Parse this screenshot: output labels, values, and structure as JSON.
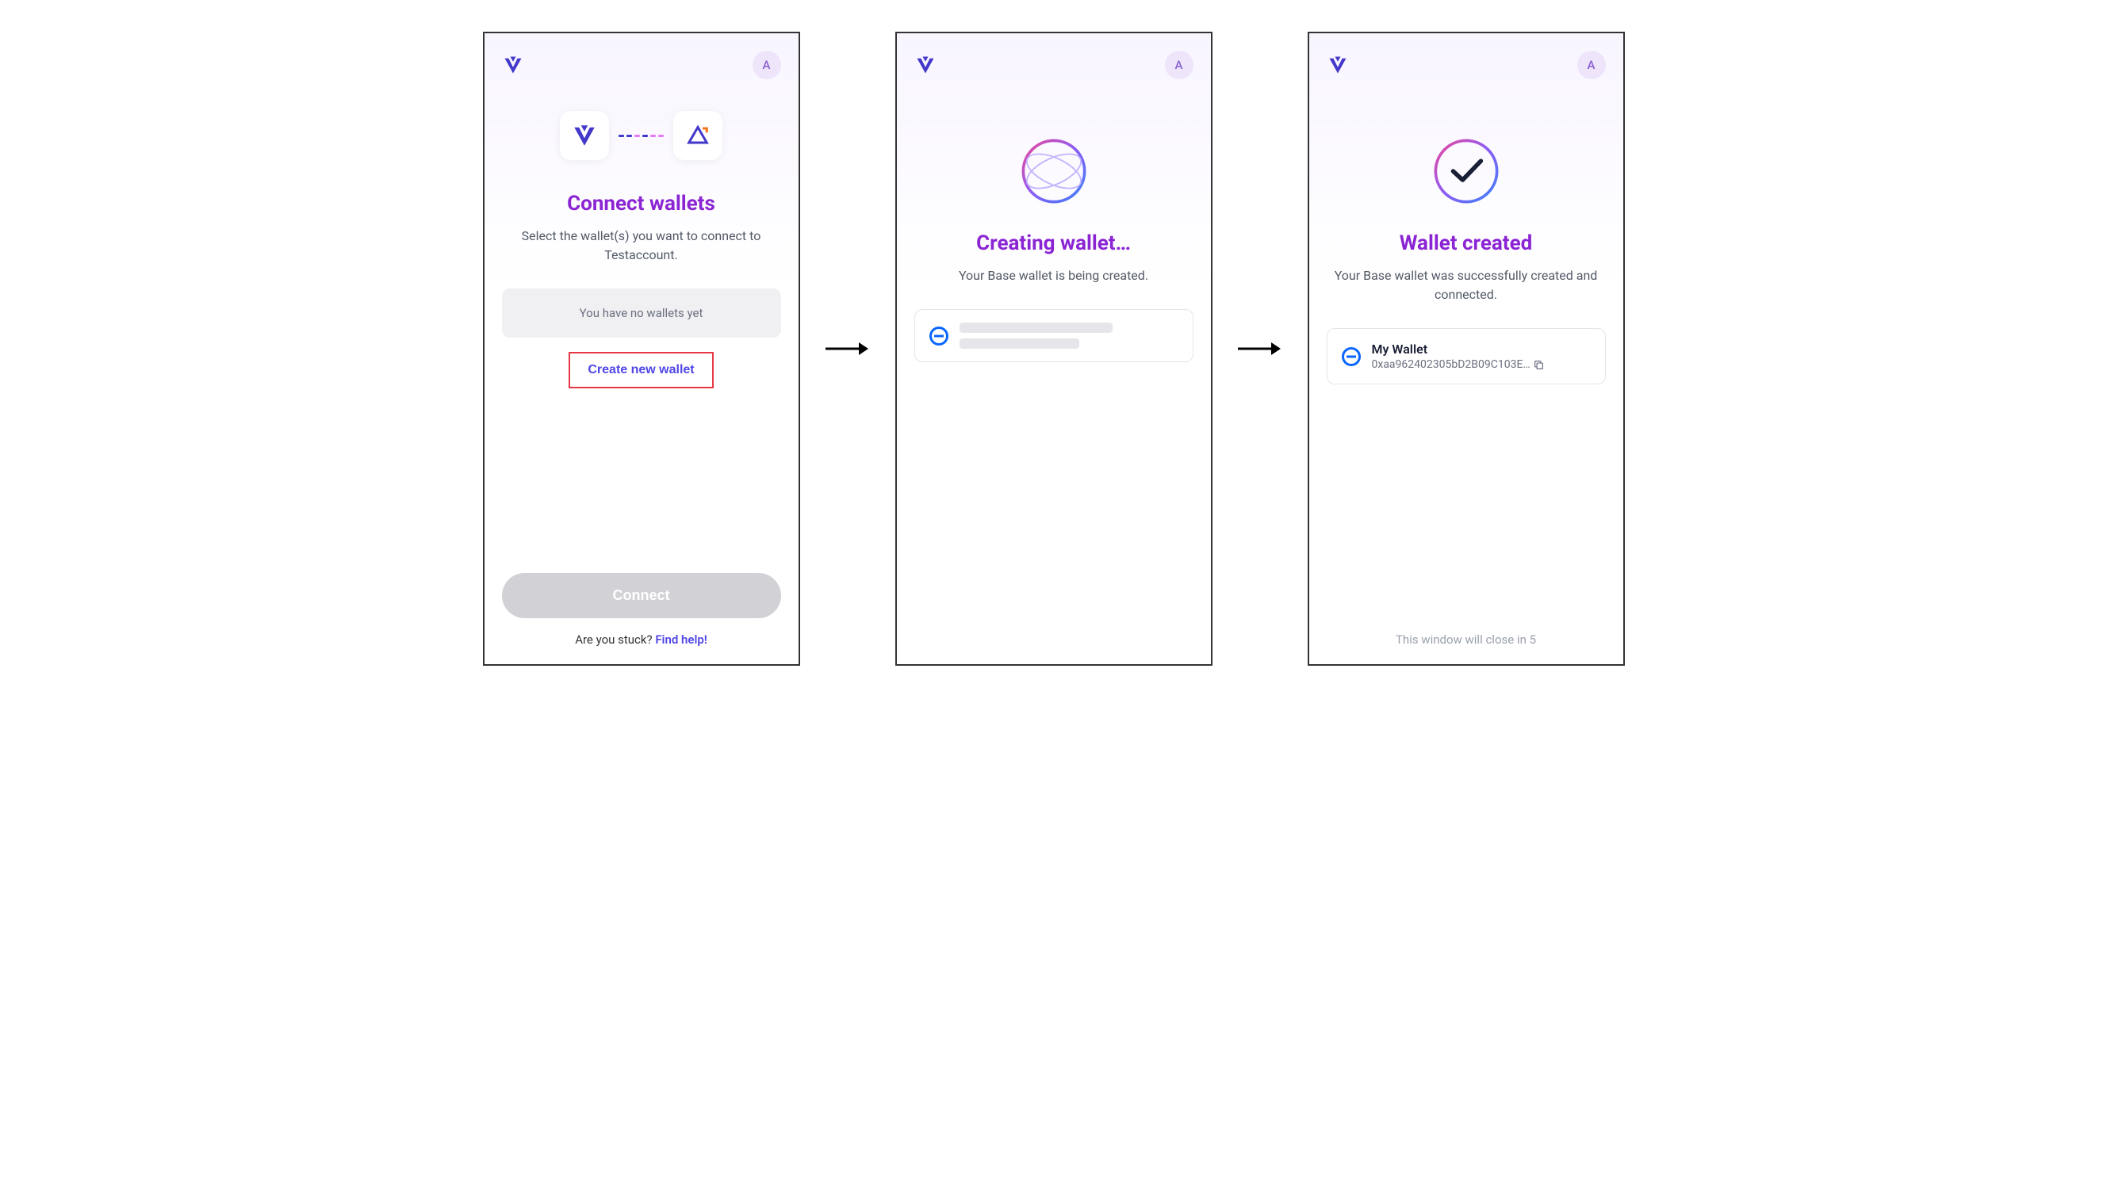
{
  "avatar_letter": "A",
  "panel1": {
    "title": "Connect wallets",
    "subtitle": "Select the wallet(s) you want to connect to Testaccount.",
    "empty_msg": "You have no wallets yet",
    "create_btn": "Create new wallet",
    "connect_btn": "Connect",
    "stuck_text": "Are you stuck? ",
    "help_link": "Find help!"
  },
  "panel2": {
    "title": "Creating wallet…",
    "subtitle": "Your Base wallet is being created."
  },
  "panel3": {
    "title": "Wallet created",
    "subtitle": "Your Base wallet was successfully created and connected.",
    "wallet_name": "My Wallet",
    "wallet_addr": "0xaa962402305bD2B09C103E…",
    "close_text": "This window will close in 5"
  }
}
